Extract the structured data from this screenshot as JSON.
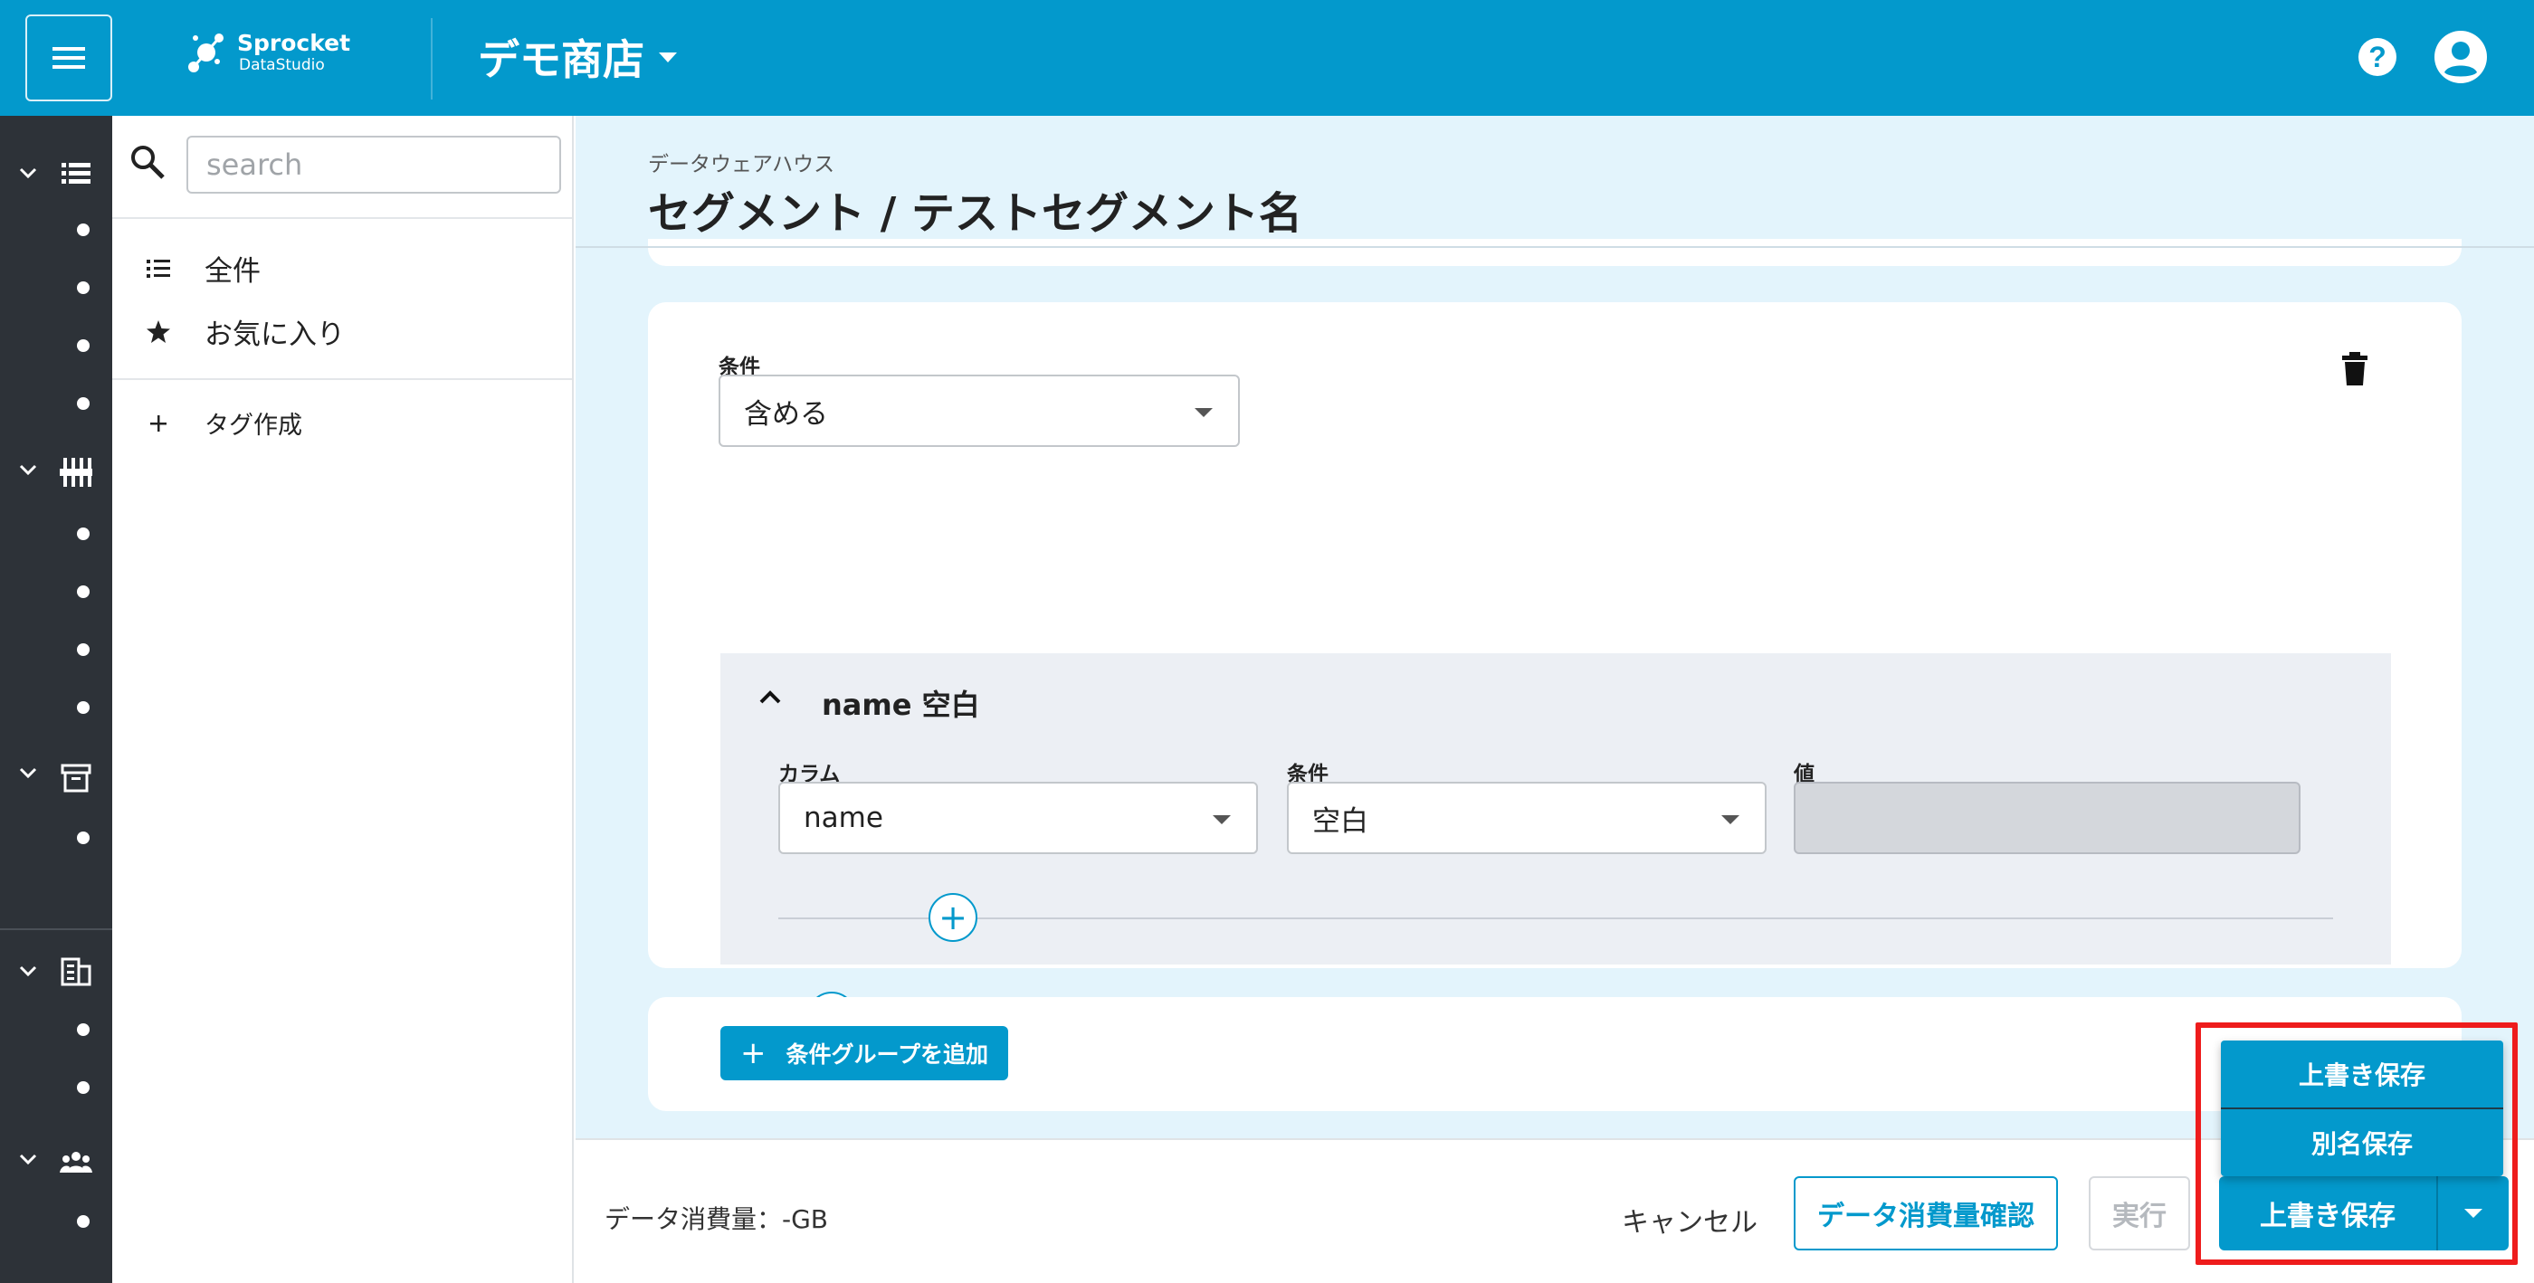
{
  "header": {
    "logo_line1": "Sprocket",
    "logo_line2": "DataStudio",
    "store_name": "デモ商店",
    "help_glyph": "?",
    "accent_color": "#0399cc"
  },
  "rail": {
    "groups": [
      {
        "icon": "list-icon",
        "items": 4
      },
      {
        "icon": "pipeline-icon",
        "items": 4
      },
      {
        "icon": "archive-icon",
        "items": 1
      },
      {
        "icon": "building-icon",
        "items": 2
      },
      {
        "icon": "people-icon",
        "items": 1
      }
    ]
  },
  "panel": {
    "search_placeholder": "search",
    "items": [
      {
        "label": "全件",
        "icon": "list-icon"
      },
      {
        "label": "お気に入り",
        "icon": "star-icon"
      },
      {
        "label": "タグ作成",
        "icon": "plus-icon"
      }
    ]
  },
  "main": {
    "breadcrumb": "データウェアハウス",
    "title": "セグメント / テストセグメント名",
    "condition_label": "条件",
    "condition_value": "含める",
    "group": {
      "title": "name 空白",
      "column_label": "カラム",
      "column_value": "name",
      "condition_label": "条件",
      "condition_value": "空白",
      "value_label": "値",
      "value_value": ""
    },
    "add_glyph": "+",
    "add_group_label": "条件グループを追加"
  },
  "footer": {
    "usage": "データ消費量：-GB",
    "cancel": "キャンセル",
    "check_usage": "データ消費量確認",
    "run": "実行",
    "save": "上書き保存"
  },
  "save_menu": {
    "items": [
      "上書き保存",
      "別名保存"
    ]
  }
}
